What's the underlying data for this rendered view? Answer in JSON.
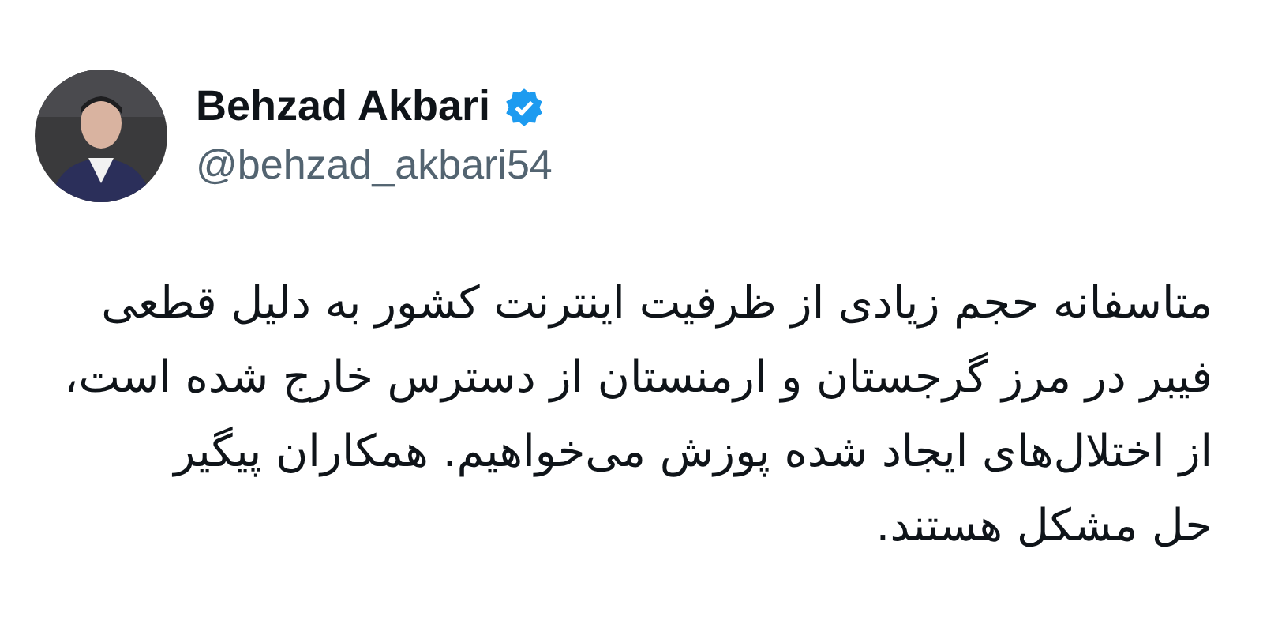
{
  "author": {
    "name": "Behzad Akbari",
    "verified": true,
    "handle": "@behzad_akbari54"
  },
  "tweet": {
    "lines": [
      "متاسفانه حجم زیادی از ظرفیت اینترنت کشور به دلیل قطعی",
      "فیبر در مرز گرجستان و ارمنستان از دسترس خارج شده است،",
      "از اختلال‌های ایجاد شده پوزش می‌خواهیم. همکاران پیگیر",
      "حل مشکل هستند."
    ]
  }
}
